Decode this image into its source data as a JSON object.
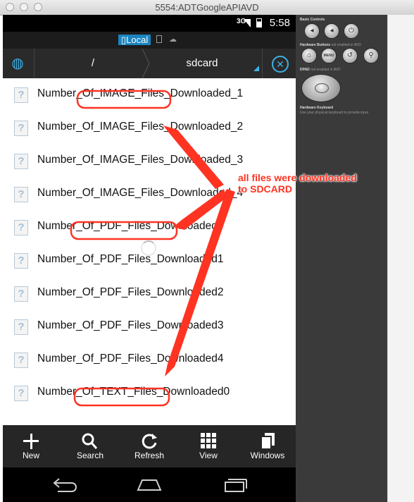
{
  "window": {
    "title": "5554:ADTGoogleAPIAVD"
  },
  "status_bar": {
    "network": "3G",
    "time": "5:58"
  },
  "location_bar": {
    "local_label": "Local"
  },
  "path_bar": {
    "root": "/",
    "current": "sdcard"
  },
  "files": [
    "Number_Of_IMAGE_Files_Downloaded_1",
    "Number_Of_IMAGE_Files_Downloaded_2",
    "Number_Of_IMAGE_Files_Downloaded_3",
    "Number_Of_IMAGE_Files_Downloaded_4",
    "Number_Of_PDF_Files_Downloaded0",
    "Number_Of_PDF_Files_Downloaded1",
    "Number_Of_PDF_Files_Downloaded2",
    "Number_Of_PDF_Files_Downloaded3",
    "Number_Of_PDF_Files_Downloaded4",
    "Number_Of_TEXT_Files_Downloaded0"
  ],
  "toolbar": [
    {
      "label": "New",
      "icon": "plus-icon"
    },
    {
      "label": "Search",
      "icon": "search-icon"
    },
    {
      "label": "Refresh",
      "icon": "refresh-icon"
    },
    {
      "label": "View",
      "icon": "grid-icon"
    },
    {
      "label": "Windows",
      "icon": "windows-icon"
    }
  ],
  "controls": {
    "basic_label": "Basic Controls",
    "hw_buttons_label": "Hardware Buttons",
    "hw_buttons_note": "not enabled in AVD",
    "dpad_label": "DPAD",
    "dpad_note": "not enabled in AVD",
    "keyboard_label": "Hardware Keyboard",
    "keyboard_note": "Use your physical keyboard to provide input",
    "menu_label": "MENU"
  },
  "annotation": {
    "line1": "all files were downloaded",
    "line2": "to SDCARD",
    "color": "#ff3322"
  }
}
